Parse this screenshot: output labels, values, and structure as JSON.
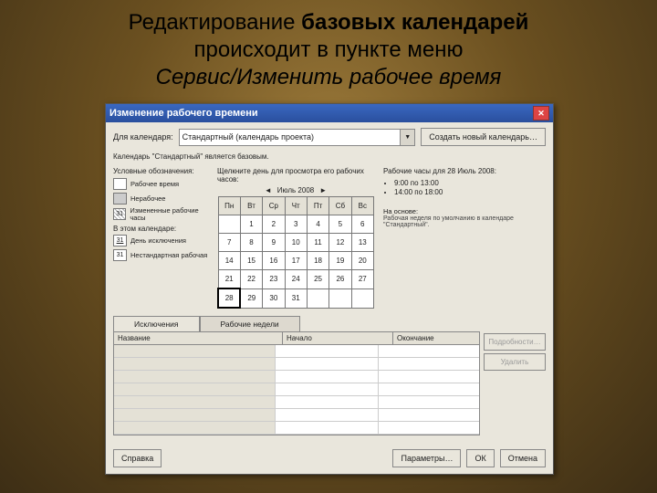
{
  "heading": {
    "l1a": "Редактирование ",
    "l1b": "базовых календарей",
    "l2": "происходит в пункте меню",
    "l3": "Сервис/Изменить рабочее время"
  },
  "window": {
    "title": "Изменение рабочего времени",
    "close": "✕",
    "for_calendar": "Для календаря:",
    "selected": "Стандартный (календарь проекта)",
    "create_new": "Создать новый календарь…",
    "base_note": "Календарь \"Стандартный\" является базовым.",
    "legend_title": "Условные обозначения:",
    "click_note": "Щелкните день для просмотра его рабочих часов:",
    "legend": {
      "work": "Рабочее время",
      "nonwork": "Нерабочее",
      "changed": "Измененные рабочие часы",
      "thiscal": "В этом календаре:",
      "exday": "День исключения",
      "nonstd": "Нестандартная рабочая"
    },
    "swatch31": "31",
    "calendar": {
      "nav_prev": "◄",
      "nav_next": "►",
      "month": "Июль 2008",
      "dow": [
        "Пн",
        "Вт",
        "Ср",
        "Чт",
        "Пт",
        "Сб",
        "Вс"
      ],
      "weeks": [
        [
          "",
          "1",
          "2",
          "3",
          "4",
          "5",
          "6"
        ],
        [
          "7",
          "8",
          "9",
          "10",
          "11",
          "12",
          "13"
        ],
        [
          "14",
          "15",
          "16",
          "17",
          "18",
          "19",
          "20"
        ],
        [
          "21",
          "22",
          "23",
          "24",
          "25",
          "26",
          "27"
        ],
        [
          "28",
          "29",
          "30",
          "31",
          "",
          "",
          ""
        ]
      ],
      "selected": "28"
    },
    "detail": {
      "title": "Рабочие часы для 28 Июль 2008:",
      "h1": "9:00 по 13:00",
      "h2": "14:00 по 18:00",
      "base_label": "На основе:",
      "base_text": "Рабочая неделя по умолчанию в календаре \"Стандартный\"."
    },
    "tabs": {
      "exceptions": "Исключения",
      "workweeks": "Рабочие недели"
    },
    "grid": {
      "name": "Название",
      "start": "Начало",
      "end": "Окончание"
    },
    "side": {
      "details": "Подробности…",
      "delete": "Удалить"
    },
    "footer": {
      "help": "Справка",
      "options": "Параметры…",
      "ok": "ОК",
      "cancel": "Отмена"
    }
  }
}
